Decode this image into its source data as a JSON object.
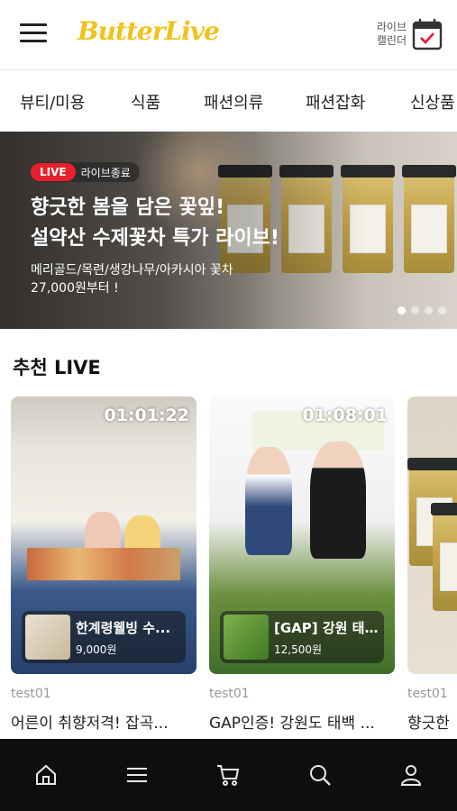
{
  "header": {
    "logo": "ButterLive",
    "calendar_label_line1": "라이브",
    "calendar_label_line2": "캘린더"
  },
  "categories": [
    "뷰티/미용",
    "식품",
    "패션의류",
    "패션잡화",
    "신상품"
  ],
  "banner": {
    "live_badge": "LIVE",
    "status": "라이브종료",
    "title_line1": "향긋한 봄을 담은 꽃잎!",
    "title_line2": "설약산 수제꽃차 특가 라이브!",
    "subtitle_line1": "메리골드/목련/생강나무/아카시아 꽃차",
    "subtitle_line2": "27,000원부터 !",
    "slide_count": 4,
    "active_slide": 1
  },
  "section": {
    "title": "추천 LIVE"
  },
  "cards": [
    {
      "timer": "01:01:22",
      "product_name": "한계령웰빙 수...",
      "product_price": "9,000원",
      "seller": "test01",
      "title": "어른이 취향저격! 잡곡..."
    },
    {
      "timer": "01:08:01",
      "product_name": "[GAP] 강원 태백...",
      "product_price": "12,500원",
      "seller": "test01",
      "title": "GAP인증! 강원도 태백 ..."
    },
    {
      "timer": "",
      "product_name": "",
      "product_price": "",
      "seller": "test01",
      "title": "향긋한"
    }
  ],
  "bottom_nav": {
    "items": [
      "home-icon",
      "menu-icon",
      "cart-icon",
      "search-icon",
      "user-icon"
    ]
  },
  "colors": {
    "brand": "#f2c21b",
    "live_red": "#e8202e",
    "bottom_nav_bg": "#0e0e0e"
  }
}
